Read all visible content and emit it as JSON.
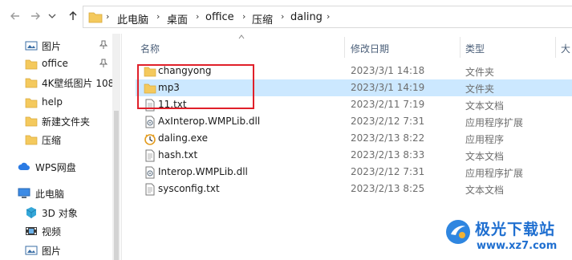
{
  "breadcrumb": [
    "此电脑",
    "桌面",
    "office",
    "压缩",
    "daling"
  ],
  "sidebar": {
    "quick_access": [
      {
        "label": "图片",
        "icon": "pictures-icon",
        "pinned": true
      },
      {
        "label": "office",
        "icon": "folder-icon",
        "pinned": true
      },
      {
        "label": "4K壁纸图片 108",
        "icon": "folder-icon",
        "pinned": false
      },
      {
        "label": "help",
        "icon": "folder-icon",
        "pinned": false
      },
      {
        "label": "新建文件夹",
        "icon": "folder-icon",
        "pinned": false
      },
      {
        "label": "压缩",
        "icon": "folder-icon",
        "pinned": false
      }
    ],
    "wps": {
      "label": "WPS网盘",
      "icon": "cloud-icon"
    },
    "this_pc": {
      "label": "此电脑",
      "icon": "computer-icon"
    },
    "pc_items": [
      {
        "label": "3D 对象",
        "icon": "3d-objects-icon"
      },
      {
        "label": "视频",
        "icon": "videos-icon"
      },
      {
        "label": "图片",
        "icon": "pictures-icon"
      }
    ]
  },
  "columns": {
    "name": "名称",
    "date": "修改日期",
    "type": "类型",
    "size": "大"
  },
  "files": [
    {
      "name": "changyong",
      "date": "2023/3/1 14:18",
      "type": "文件夹",
      "icon": "folder-icon",
      "selected": false
    },
    {
      "name": "mp3",
      "date": "2023/3/1 14:19",
      "type": "文件夹",
      "icon": "folder-icon",
      "selected": true
    },
    {
      "name": "11.txt",
      "date": "2023/2/11 7:19",
      "type": "文本文档",
      "icon": "text-file-icon",
      "selected": false
    },
    {
      "name": "AxInterop.WMPLib.dll",
      "date": "2023/2/12 7:31",
      "type": "应用程序扩展",
      "icon": "dll-icon",
      "selected": false
    },
    {
      "name": "daling.exe",
      "date": "2023/2/13 8:22",
      "type": "应用程序",
      "icon": "exe-icon",
      "selected": false
    },
    {
      "name": "hash.txt",
      "date": "2023/2/13 8:33",
      "type": "文本文档",
      "icon": "text-file-icon",
      "selected": false
    },
    {
      "name": "Interop.WMPLib.dll",
      "date": "2023/2/12 7:31",
      "type": "应用程序扩展",
      "icon": "dll-icon",
      "selected": false
    },
    {
      "name": "sysconfig.txt",
      "date": "2023/2/13 8:25",
      "type": "文本文档",
      "icon": "text-file-icon",
      "selected": false
    }
  ],
  "watermark": {
    "name": "极光下载站",
    "url": "www.xz7.com"
  },
  "colors": {
    "selection": "#cce8ff",
    "folder": "#f4c95d",
    "highlight": "#e0202a",
    "brand": "#1f6fd0"
  }
}
